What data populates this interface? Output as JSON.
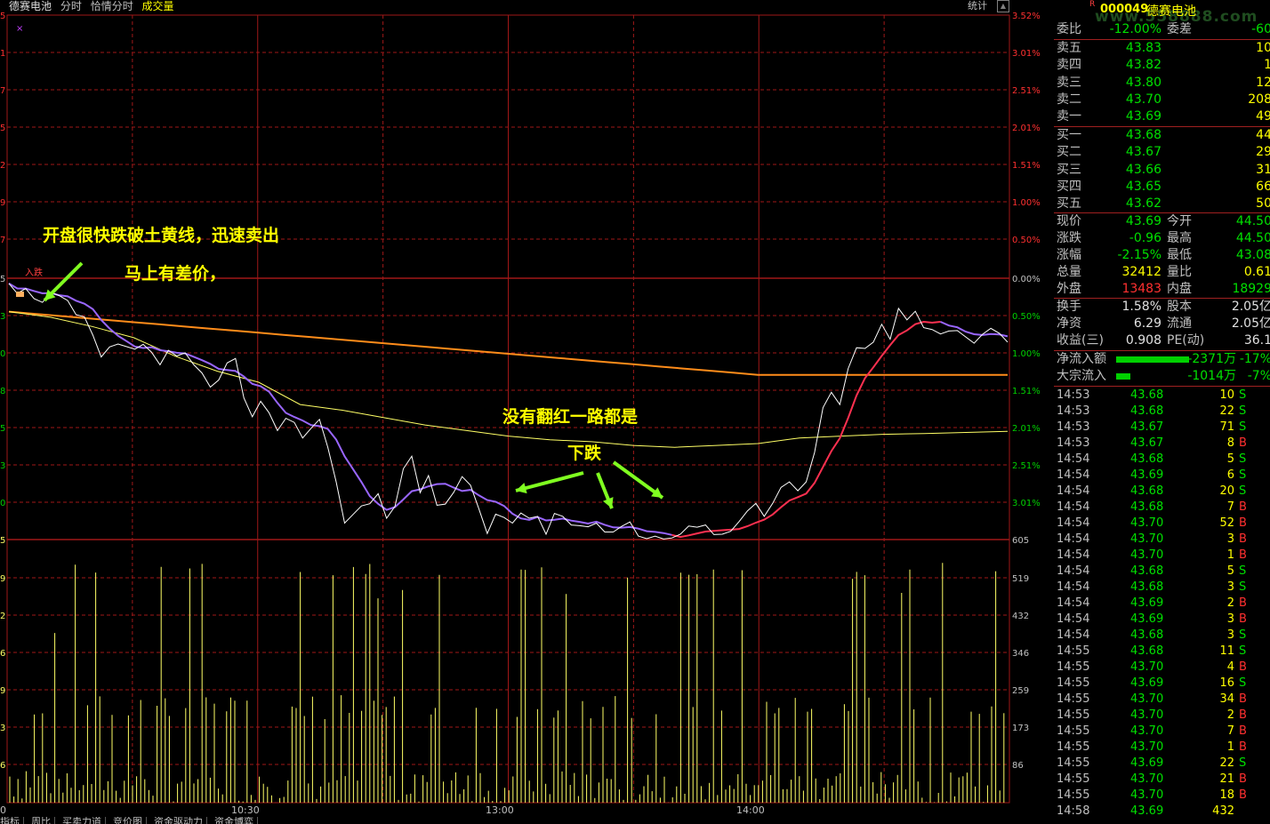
{
  "tabs": {
    "stock": "德赛电池",
    "t1": "分时",
    "t2": "恰情分时",
    "t3": "成交量"
  },
  "stats_label": "统计",
  "bottom_tabs": [
    "指标",
    "周比",
    "买卖力道",
    "竞价图",
    "资金驱动力",
    "资金博弈"
  ],
  "annotations": {
    "a1": "开盘很快跌破土黄线，迅速卖出",
    "a2": "马上有差价，",
    "a3": "没有翻红一路都是",
    "a4": "下跌",
    "a5": "入跌"
  },
  "left_axis": [
    "5",
    "1",
    "7",
    "5",
    "2",
    "9",
    "7",
    "5",
    "3",
    "0",
    "8",
    "5",
    "3",
    "0",
    "5",
    "9",
    "2",
    "6",
    "9",
    "3",
    "6"
  ],
  "pct_axis": [
    "3.52%",
    "3.01%",
    "2.51%",
    "2.01%",
    "1.51%",
    "1.00%",
    "0.50%",
    "0.00%",
    "0.50%",
    "1.00%",
    "1.51%",
    "2.01%",
    "2.51%",
    "3.01%"
  ],
  "vol_axis": [
    "605",
    "519",
    "432",
    "346",
    "259",
    "173",
    "86"
  ],
  "time_axis": [
    "10:30",
    "13:00",
    "14:00"
  ],
  "time_axis_left": "0",
  "colors": {
    "grid": "#a01818",
    "price": "#ffffff",
    "avg": "#ffff66",
    "orange": "#ff8c1a",
    "purple": "#9966ff",
    "red": "#ff3050",
    "volume": "#ffff66"
  },
  "price_series": [
    0.14,
    0.41,
    0.28,
    0.55,
    0.65,
    0.38,
    0.47,
    0.6,
    0.98,
    1.04,
    1.53,
    2.12,
    1.85,
    1.77,
    1.84,
    1.91,
    1.78,
    1.99,
    2.33,
    1.94,
    2.09,
    2.01,
    2.32,
    2.55,
    2.93,
    2.74,
    2.28,
    2.16,
    3.22,
    3.73,
    3.31,
    3.62,
    4.1,
    3.77,
    3.88,
    4.3,
    4.04,
    3.8,
    4.55,
    5.48,
    6.59,
    6.36,
    6.13,
    6.07,
    5.8,
    6.46,
    6.14,
    5.13,
    4.79,
    5.77,
    5.31,
    6.11,
    6.08,
    5.76,
    5.34,
    5.57,
    6.21,
    6.87,
    6.35,
    6.44,
    6.59,
    6.32,
    6.46,
    6.41,
    6.89,
    6.33,
    6.41,
    6.64,
    6.66,
    6.69,
    6.59,
    6.83,
    6.83,
    6.68,
    6.56,
    6.94,
    7.01,
    6.94,
    7.02,
    6.99,
    6.89,
    6.67,
    6.7,
    6.64,
    6.9,
    6.89,
    6.81,
    6.55,
    6.26,
    6.06,
    6.41,
    6.06,
    5.63,
    5.48,
    5.72,
    5.48,
    4.69,
    3.48,
    3.07,
    3.4,
    2.43,
    1.87,
    1.89,
    1.72,
    1.24,
    1.64,
    0.81,
    1.12,
    0.89,
    1.33,
    1.38,
    1.5,
    1.42,
    1.41,
    1.58,
    1.75,
    1.51,
    1.35,
    1.48,
    1.72
  ],
  "panel": {
    "code": "000049",
    "name": "德赛电池",
    "rtag": "R",
    "logo": "www.558888.com",
    "weibi_label": "委比",
    "weibi": "-12.00%",
    "weicha_label": "委差",
    "weicha": "-60",
    "asks": [
      {
        "label": "卖五",
        "price": "43.83",
        "vol": "10"
      },
      {
        "label": "卖四",
        "price": "43.82",
        "vol": "1"
      },
      {
        "label": "卖三",
        "price": "43.80",
        "vol": "12"
      },
      {
        "label": "卖二",
        "price": "43.70",
        "vol": "208"
      },
      {
        "label": "卖一",
        "price": "43.69",
        "vol": "49"
      }
    ],
    "bids": [
      {
        "label": "买一",
        "price": "43.68",
        "vol": "44"
      },
      {
        "label": "买二",
        "price": "43.67",
        "vol": "29"
      },
      {
        "label": "买三",
        "price": "43.66",
        "vol": "31"
      },
      {
        "label": "买四",
        "price": "43.65",
        "vol": "66"
      },
      {
        "label": "买五",
        "price": "43.62",
        "vol": "50"
      }
    ],
    "quote": [
      {
        "k": "现价",
        "v": "43.69",
        "vc": "g",
        "k2": "今开",
        "v2": "44.50",
        "v2c": "g"
      },
      {
        "k": "涨跌",
        "v": "-0.96",
        "vc": "g",
        "k2": "最高",
        "v2": "44.50",
        "v2c": "g"
      },
      {
        "k": "涨幅",
        "v": "-2.15%",
        "vc": "g",
        "k2": "最低",
        "v2": "43.08",
        "v2c": "g"
      },
      {
        "k": "总量",
        "v": "32412",
        "vc": "y",
        "k2": "量比",
        "v2": "0.61",
        "v2c": "y"
      },
      {
        "k": "外盘",
        "v": "13483",
        "vc": "r",
        "k2": "内盘",
        "v2": "18929",
        "v2c": "g"
      }
    ],
    "fund": [
      {
        "k": "换手",
        "v": "1.58%",
        "k2": "股本",
        "v2": "2.05亿"
      },
      {
        "k": "净资",
        "v": "6.29",
        "k2": "流通",
        "v2": "2.05亿"
      },
      {
        "k": "收益(三)",
        "v": "0.908",
        "k2": "PE(动)",
        "v2": "36.1"
      }
    ],
    "flow": [
      {
        "k": "净流入额",
        "v": "-2371万",
        "p": "-17%",
        "bar": 1.0
      },
      {
        "k": "大宗流入",
        "v": "-1014万",
        "p": "-7%",
        "bar": 0.2
      }
    ],
    "ticks": [
      {
        "t": "14:53",
        "p": "43.68",
        "v": "10",
        "bs": "S"
      },
      {
        "t": "14:53",
        "p": "43.68",
        "v": "22",
        "bs": "S"
      },
      {
        "t": "14:53",
        "p": "43.67",
        "v": "71",
        "bs": "S"
      },
      {
        "t": "14:53",
        "p": "43.67",
        "v": "8",
        "bs": "B"
      },
      {
        "t": "14:54",
        "p": "43.68",
        "v": "5",
        "bs": "S"
      },
      {
        "t": "14:54",
        "p": "43.69",
        "v": "6",
        "bs": "S"
      },
      {
        "t": "14:54",
        "p": "43.68",
        "v": "20",
        "bs": "S"
      },
      {
        "t": "14:54",
        "p": "43.68",
        "v": "7",
        "bs": "B"
      },
      {
        "t": "14:54",
        "p": "43.70",
        "v": "52",
        "bs": "B"
      },
      {
        "t": "14:54",
        "p": "43.70",
        "v": "3",
        "bs": "B"
      },
      {
        "t": "14:54",
        "p": "43.70",
        "v": "1",
        "bs": "B"
      },
      {
        "t": "14:54",
        "p": "43.68",
        "v": "5",
        "bs": "S"
      },
      {
        "t": "14:54",
        "p": "43.68",
        "v": "3",
        "bs": "S"
      },
      {
        "t": "14:54",
        "p": "43.69",
        "v": "2",
        "bs": "B"
      },
      {
        "t": "14:54",
        "p": "43.69",
        "v": "3",
        "bs": "B"
      },
      {
        "t": "14:54",
        "p": "43.68",
        "v": "3",
        "bs": "S"
      },
      {
        "t": "14:55",
        "p": "43.68",
        "v": "11",
        "bs": "S"
      },
      {
        "t": "14:55",
        "p": "43.70",
        "v": "4",
        "bs": "B"
      },
      {
        "t": "14:55",
        "p": "43.69",
        "v": "16",
        "bs": "S"
      },
      {
        "t": "14:55",
        "p": "43.70",
        "v": "34",
        "bs": "B"
      },
      {
        "t": "14:55",
        "p": "43.70",
        "v": "2",
        "bs": "B"
      },
      {
        "t": "14:55",
        "p": "43.70",
        "v": "7",
        "bs": "B"
      },
      {
        "t": "14:55",
        "p": "43.70",
        "v": "1",
        "bs": "B"
      },
      {
        "t": "14:55",
        "p": "43.69",
        "v": "22",
        "bs": "S"
      },
      {
        "t": "14:55",
        "p": "43.70",
        "v": "21",
        "bs": "B"
      },
      {
        "t": "14:55",
        "p": "43.70",
        "v": "18",
        "bs": "B"
      },
      {
        "t": "14:58",
        "p": "43.69",
        "v": "432",
        "bs": ""
      }
    ]
  }
}
